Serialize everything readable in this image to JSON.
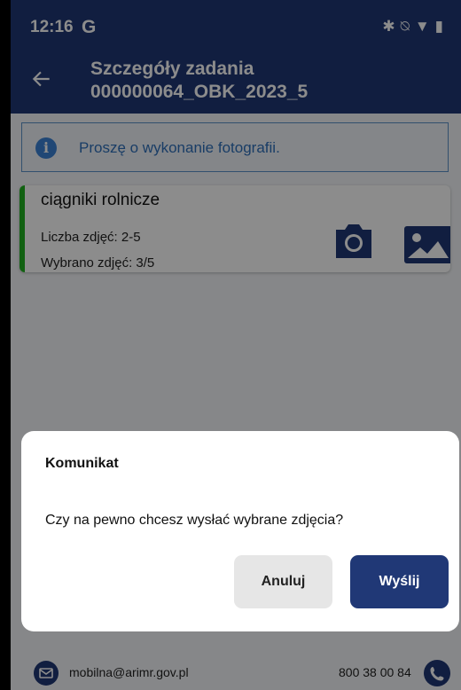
{
  "status_bar": {
    "time": "12:16",
    "app_badge": "G",
    "icons": [
      "bluetooth-icon",
      "silent-icon",
      "wifi-icon",
      "battery-icon"
    ]
  },
  "header": {
    "title": "Szczegóły zadania",
    "subtitle": "000000064_OBK_2023_5"
  },
  "info": {
    "message": "Proszę o wykonanie fotografii."
  },
  "task": {
    "title": "ciągniki rolnicze",
    "photo_count": "Liczba zdjęć: 2-5",
    "selected_count": "Wybrano zdjęć: 3/5",
    "status_color": "#1fb11f"
  },
  "dialog": {
    "title": "Komunikat",
    "message": "Czy na pewno chcesz wysłać wybrane zdjęcia?",
    "cancel_label": "Anuluj",
    "send_label": "Wyślij"
  },
  "footer": {
    "email": "mobilna@arimr.gov.pl",
    "phone": "800 38 00 84"
  },
  "colors": {
    "primary": "#203876",
    "info": "#3b82d6"
  }
}
